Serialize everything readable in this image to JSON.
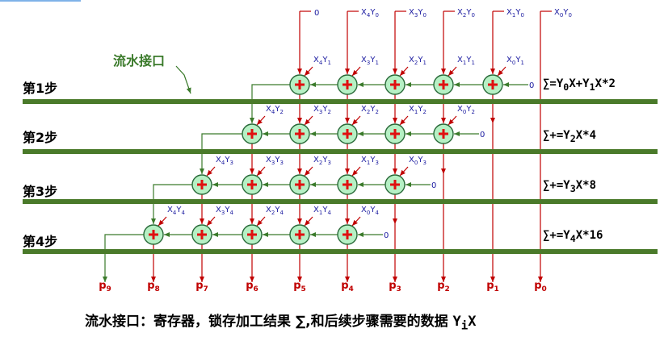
{
  "pipeline_label": "流水接口",
  "steps": [
    {
      "label": "第1步",
      "formula_parts": [
        "∑=Y",
        "0",
        "X+Y",
        "1",
        "X*2"
      ]
    },
    {
      "label": "第2步",
      "formula_parts": [
        "∑+=Y",
        "2",
        "X*4"
      ]
    },
    {
      "label": "第3步",
      "formula_parts": [
        "∑+=Y",
        "3",
        "X*8"
      ]
    },
    {
      "label": "第4步",
      "formula_parts": [
        "∑+=Y",
        "4",
        "X*16"
      ]
    }
  ],
  "top_inputs": [
    "0",
    "X4Y0",
    "X3Y0",
    "X2Y0",
    "X1Y0",
    "X0Y0"
  ],
  "row_inputs": [
    [
      "X4Y1",
      "X3Y1",
      "X2Y1",
      "X1Y1",
      "X0Y1"
    ],
    [
      "X4Y2",
      "X3Y2",
      "X2Y2",
      "X1Y2",
      "X0Y2"
    ],
    [
      "X4Y3",
      "X3Y3",
      "X2Y3",
      "X1Y3",
      "X0Y3"
    ],
    [
      "X4Y4",
      "X3Y4",
      "X2Y4",
      "X1Y4",
      "X0Y4"
    ]
  ],
  "zero_label": "0",
  "outputs": [
    "p9",
    "p8",
    "p7",
    "p6",
    "p5",
    "p4",
    "p3",
    "p2",
    "p1",
    "p0"
  ],
  "caption": {
    "text": "流水接口：寄存器，锁存加工结果 ∑,和后续步骤需要的数据 ",
    "var_main": "Y",
    "var_sub": "i",
    "var_tail": "X"
  },
  "colors": {
    "bar": "#4a7a2a",
    "adder_fill": "#b6f0c4",
    "adder_stroke": "#2a6a3a",
    "plus": "#e01010",
    "red_line": "#c00000",
    "green_line": "#3a7a2a",
    "term_text": "#1a1aa0",
    "output_text": "#c00000"
  }
}
